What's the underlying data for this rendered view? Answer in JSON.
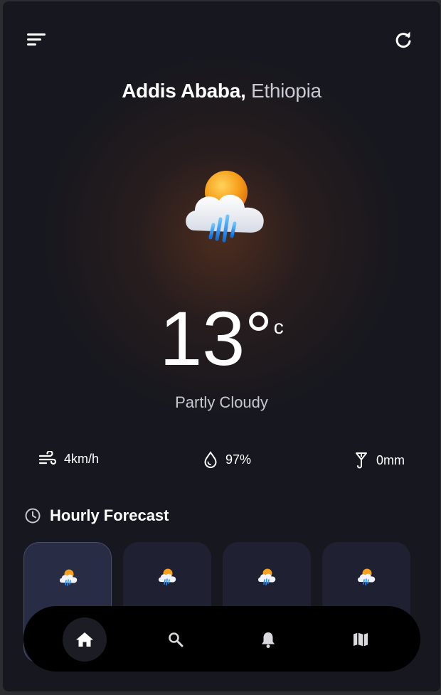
{
  "location": {
    "city": "Addis Ababa,",
    "country": "Ethiopia"
  },
  "current": {
    "temperature": "13",
    "degree_symbol": "°",
    "unit": "c",
    "condition": "Partly Cloudy",
    "icon": "sun-cloud-rain-icon"
  },
  "stats": {
    "wind": {
      "icon": "wind-icon",
      "value": "4km/h"
    },
    "humidity": {
      "icon": "water-drop-icon",
      "value": "97%"
    },
    "precipitation": {
      "icon": "umbrella-icon",
      "value": "0mm"
    }
  },
  "hourly": {
    "title": "Hourly Forecast",
    "icon": "clock-icon",
    "cards": [
      {
        "icon": "sun-cloud-rain-icon",
        "active": true
      },
      {
        "icon": "sun-cloud-rain-icon",
        "active": false
      },
      {
        "icon": "sun-cloud-rain-icon",
        "active": false
      },
      {
        "icon": "sun-cloud-rain-icon",
        "active": false
      }
    ]
  },
  "nav": {
    "items": [
      {
        "icon": "home-icon",
        "active": true
      },
      {
        "icon": "search-icon",
        "active": false
      },
      {
        "icon": "bell-icon",
        "active": false
      },
      {
        "icon": "map-icon",
        "active": false
      }
    ]
  },
  "toolbar": {
    "menu_icon": "menu-icon",
    "refresh_icon": "refresh-icon"
  },
  "colors": {
    "background": "#16171f",
    "card": "#1f2133",
    "card_active": "#282c45",
    "nav_bar": "#000000",
    "text_primary": "#ffffff",
    "text_secondary": "#c7c8d0",
    "sun": "#f7a11d",
    "rain": "#1e90ff"
  }
}
